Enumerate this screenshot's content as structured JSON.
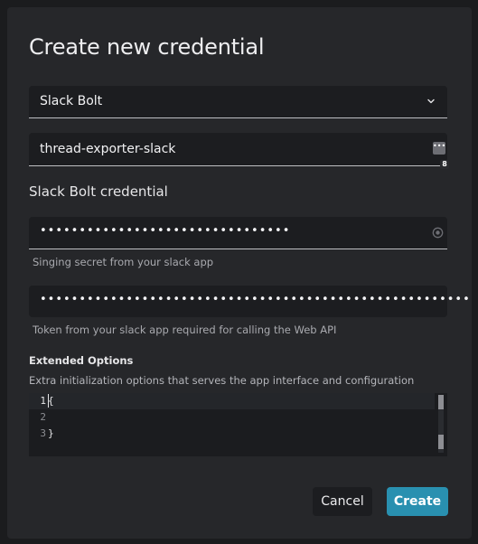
{
  "dialog": {
    "title": "Create new credential",
    "credential_type": {
      "selected": "Slack Bolt"
    },
    "credential_name": {
      "value": "thread-exporter-slack",
      "password_manager_count": "8"
    },
    "section_heading": "Slack Bolt credential",
    "signing_secret": {
      "value": "••••••••••••••••••••••••••••••••",
      "helper": "Singing secret from your slack app"
    },
    "bot_token": {
      "value": "•••••••••••••••••••••••••••••••••••••••••••••••••••••••",
      "helper": "Token from your slack app required for calling the Web API"
    },
    "extended_options": {
      "heading": "Extended Options",
      "description": "Extra initialization options that serves the app interface and configuration",
      "lines": [
        {
          "number": "1",
          "code": "{"
        },
        {
          "number": "2",
          "code": ""
        },
        {
          "number": "3",
          "code": "}"
        }
      ]
    },
    "buttons": {
      "cancel": "Cancel",
      "create": "Create"
    }
  },
  "colors": {
    "background": "#1b1c1e",
    "dialog": "#26272a",
    "field": "#1c1d20",
    "primary": "#2990b0"
  },
  "icons": {
    "select": "chevron-down-icon",
    "name_field": "password-manager-icon",
    "secret_field": "eye-icon"
  }
}
